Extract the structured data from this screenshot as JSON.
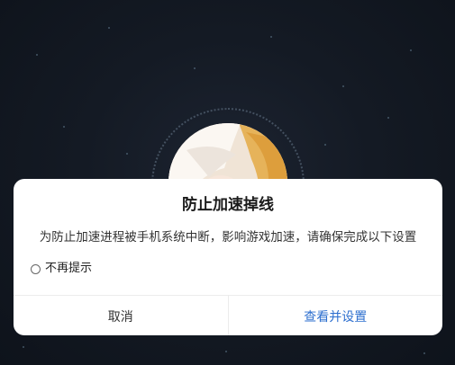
{
  "dialog": {
    "title": "防止加速掉线",
    "message": "为防止加速进程被手机系统中断，影响游戏加速，请确保完成以下设置",
    "checkbox_label": "不再提示",
    "checkbox_checked": false,
    "cancel_label": "取消",
    "confirm_label": "查看并设置"
  },
  "colors": {
    "background": "#141a24",
    "dialog_background": "#ffffff",
    "confirm_text": "#2d6fcf",
    "cancel_text": "#333333"
  },
  "icons": {
    "avatar": "anime-character-avatar",
    "checkbox": "radio-circle-icon"
  }
}
